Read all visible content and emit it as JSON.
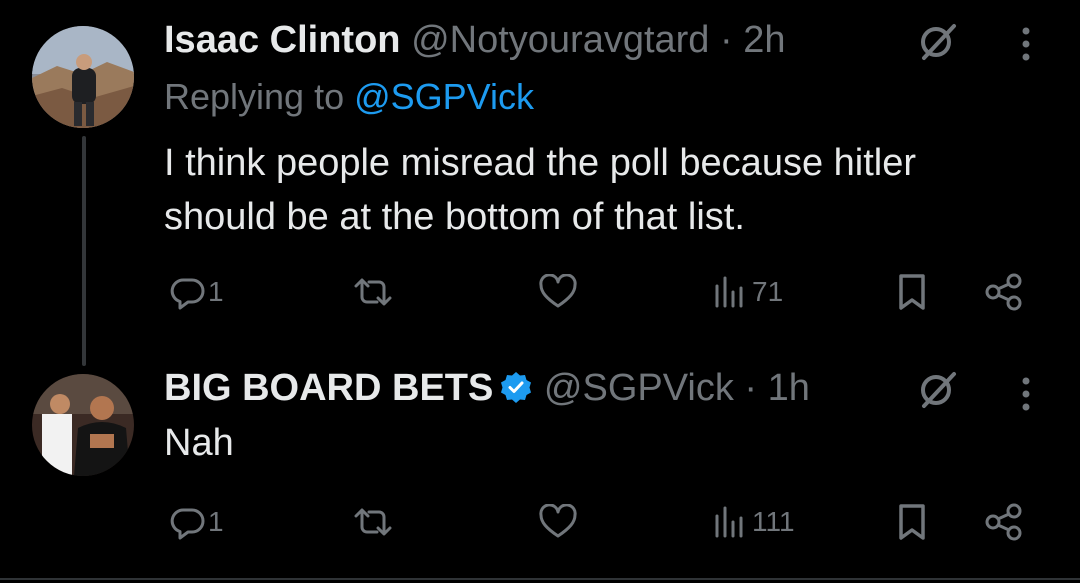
{
  "tweets": [
    {
      "name": "Isaac Clinton",
      "handle": "@Notyouravgtard",
      "separator": "·",
      "time": "2h",
      "replying_prefix": "Replying to ",
      "replying_to": "@SGPVick",
      "text_line1": "I think people misread the poll because hitler",
      "text_line2": "should be at the bottom of that list.",
      "replies": "1",
      "views": "71"
    },
    {
      "name": "BIG BOARD BETS",
      "verified": true,
      "handle": "@SGPVick",
      "separator": "·",
      "time": "1h",
      "text_line1": "Nah",
      "replies": "1",
      "views": "111"
    }
  ],
  "icons": {
    "reply": "reply-icon",
    "retweet": "retweet-icon",
    "like": "heart-icon",
    "views": "views-icon",
    "bookmark": "bookmark-icon",
    "share": "share-icon",
    "grok": "grok-icon",
    "more": "more-vertical-icon",
    "verified": "verified-badge-icon"
  },
  "colors": {
    "background": "#000000",
    "text_primary": "#e7e9ea",
    "text_secondary": "#71767b",
    "accent": "#1d9bf0",
    "thread_line": "#333639"
  }
}
